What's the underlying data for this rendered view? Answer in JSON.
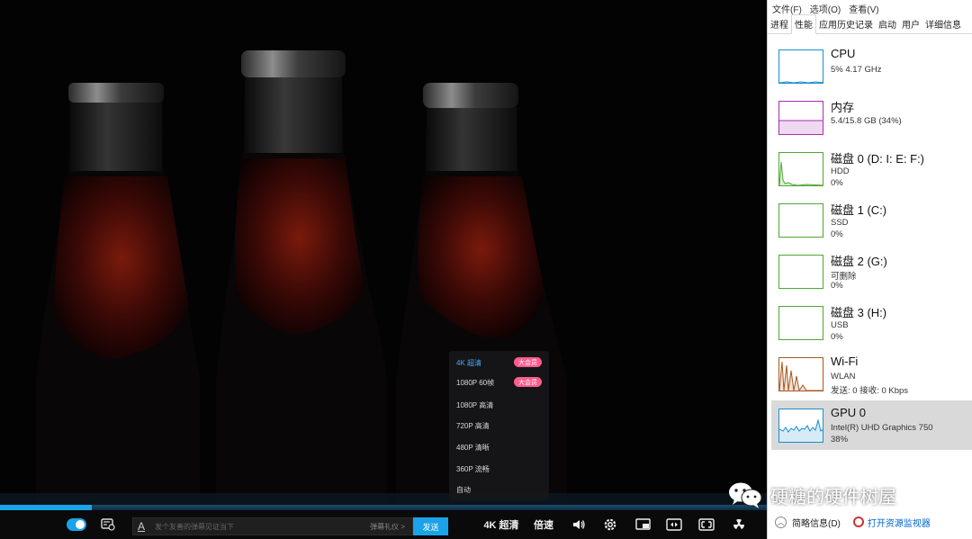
{
  "video": {
    "quality_menu": {
      "items": [
        {
          "label": "4K 超清",
          "badge": "大会员",
          "active": true
        },
        {
          "label": "1080P 60帧",
          "badge": "大会员",
          "active": false
        },
        {
          "label": "1080P 高清",
          "badge": "",
          "active": false
        },
        {
          "label": "720P 高清",
          "badge": "",
          "active": false
        },
        {
          "label": "480P 清晰",
          "badge": "",
          "active": false
        },
        {
          "label": "360P 流畅",
          "badge": "",
          "active": false
        },
        {
          "label": "自动",
          "badge": "",
          "active": false
        }
      ]
    },
    "progress_fraction": 0.12,
    "controls": {
      "danmu_placeholder": "发个友善的弹幕见证当下",
      "danmu_etiquette": "弹幕礼仪 >",
      "send_label": "发送",
      "quality_label": "4K 超清",
      "speed_label": "倍速"
    },
    "watermark": "硬糖的硬件树屋",
    "colors": {
      "accent": "#1aa3e8",
      "vip_badge": "#ff5c8d"
    }
  },
  "task_manager": {
    "menu": [
      "文件(F)",
      "选项(O)",
      "查看(V)"
    ],
    "tabs": [
      {
        "label": "进程",
        "active": false
      },
      {
        "label": "性能",
        "active": true
      },
      {
        "label": "应用历史记录",
        "active": false
      },
      {
        "label": "启动",
        "active": false
      },
      {
        "label": "用户",
        "active": false
      },
      {
        "label": "详细信息",
        "active": false
      }
    ],
    "items": [
      {
        "title": "CPU",
        "line1": "5% 4.17 GHz",
        "line2": "",
        "color": "#1a8fcf",
        "selected": false
      },
      {
        "title": "内存",
        "line1": "5.4/15.8 GB (34%)",
        "line2": "",
        "color": "#a62fb3",
        "selected": false
      },
      {
        "title": "磁盘 0 (D: I: E: F:)",
        "line1": "HDD",
        "line2": "0%",
        "color": "#4ea832",
        "selected": false
      },
      {
        "title": "磁盘 1 (C:)",
        "line1": "SSD",
        "line2": "0%",
        "color": "#4ea832",
        "selected": false
      },
      {
        "title": "磁盘 2 (G:)",
        "line1": "可删除",
        "line2": "0%",
        "color": "#4ea832",
        "selected": false
      },
      {
        "title": "磁盘 3 (H:)",
        "line1": "USB",
        "line2": "0%",
        "color": "#4ea832",
        "selected": false
      },
      {
        "title": "Wi-Fi",
        "line1": "WLAN",
        "line2": "发送: 0 接收: 0 Kbps",
        "color": "#a7581f",
        "selected": false
      },
      {
        "title": "GPU 0",
        "line1": "Intel(R) UHD Graphics 750",
        "line2": "38%",
        "color": "#1a8fcf",
        "selected": true
      }
    ],
    "footer": {
      "less_label": "简略信息(D)",
      "resource_monitor_label": "打开资源监视器"
    }
  }
}
